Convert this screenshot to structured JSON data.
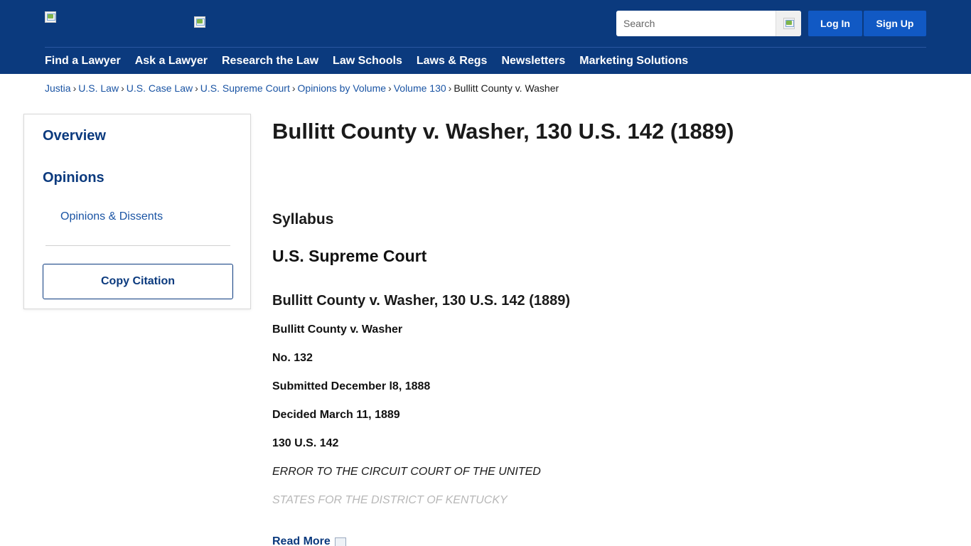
{
  "header": {
    "logo_icon": "broken-image-icon",
    "secondary_logo_icon": "broken-image-icon",
    "search": {
      "placeholder": "Search",
      "button_icon": "broken-image-icon"
    },
    "login_label": "Log In",
    "signup_label": "Sign Up",
    "colors": {
      "background": "#0b3a7e",
      "button": "#1159c4"
    }
  },
  "nav": {
    "items": [
      {
        "label": "Find a Lawyer"
      },
      {
        "label": "Ask a Lawyer"
      },
      {
        "label": "Research the Law"
      },
      {
        "label": "Law Schools"
      },
      {
        "label": "Laws & Regs"
      },
      {
        "label": "Newsletters"
      },
      {
        "label": "Marketing Solutions"
      }
    ]
  },
  "breadcrumb": {
    "items": [
      "Justia",
      "U.S. Law",
      "U.S. Case Law",
      "U.S. Supreme Court",
      "Opinions by Volume",
      "Volume 130"
    ],
    "current": "Bullitt County v. Washer",
    "separator": "›"
  },
  "sidebar": {
    "overview": "Overview",
    "opinions": "Opinions",
    "opinions_sub": "Opinions & Dissents",
    "copy_citation": "Copy Citation"
  },
  "main": {
    "title": "Bullitt County v. Washer, 130 U.S. 142 (1889)",
    "syllabus_heading": "Syllabus",
    "court": "U.S. Supreme Court",
    "case_title": "Bullitt County v. Washer, 130 U.S. 142 (1889)",
    "meta": [
      "Bullitt County v. Washer",
      "No. 132",
      "Submitted December l8, 1888",
      "Decided March 11, 1889",
      "130 U.S. 142"
    ],
    "error_line_1": "ERROR TO THE CIRCUIT COURT OF THE UNITED",
    "error_line_2": "STATES FOR THE DISTRICT OF KENTUCKY",
    "read_more": "Read More",
    "read_more_icon": "external-page-icon"
  }
}
